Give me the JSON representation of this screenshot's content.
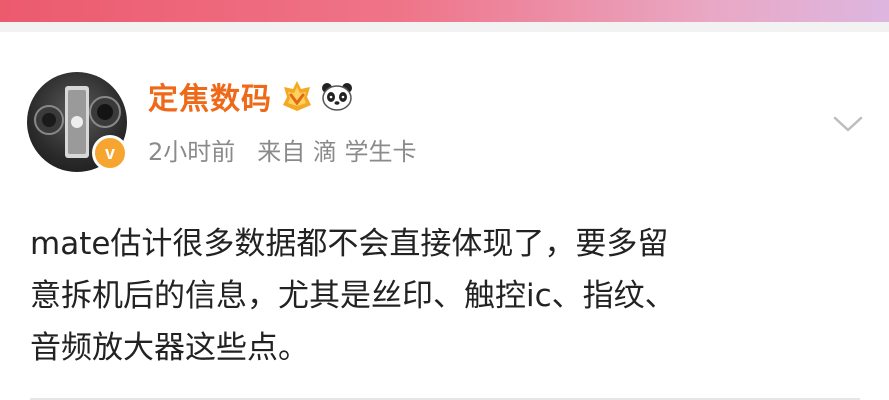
{
  "colors": {
    "top_bar_start": "#ec5a6e",
    "top_bar_end": "#ddb6e0",
    "username": "#ef6a18",
    "meta_text": "#8a8a8a",
    "body_text": "#222222",
    "verified_badge": "#f7a531"
  },
  "post": {
    "author": {
      "name": "定焦数码",
      "verified_mark": "v",
      "badges": [
        "vip-crown-icon",
        "panda-icon"
      ]
    },
    "meta": {
      "time": "2小时前",
      "source": "来自 滴 学生卡"
    },
    "content_lines": [
      "mate估计很多数据都不会直接体现了，要多留",
      "意拆机后的信息，尤其是丝印、触控ic、指纹、",
      "音频放大器这些点。"
    ]
  }
}
